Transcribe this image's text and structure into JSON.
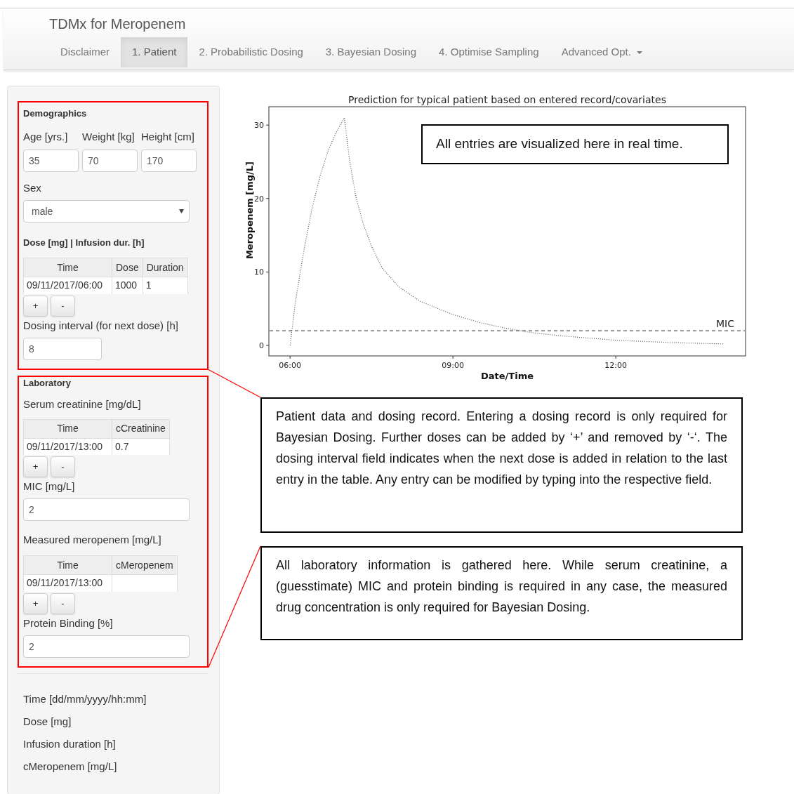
{
  "app_title": "TDMx for Meropenem",
  "tabs": [
    {
      "label": "Disclaimer",
      "selected": false,
      "has_menu": false
    },
    {
      "label": "1. Patient",
      "selected": true,
      "has_menu": false
    },
    {
      "label": "2. Probabilistic Dosing",
      "selected": false,
      "has_menu": false
    },
    {
      "label": "3. Bayesian Dosing",
      "selected": false,
      "has_menu": false
    },
    {
      "label": "4. Optimise Sampling",
      "selected": false,
      "has_menu": false
    },
    {
      "label": "Advanced Opt.",
      "selected": false,
      "has_menu": true
    }
  ],
  "sidebar": {
    "sections": [
      {
        "title": "Demographics",
        "highlighted": true,
        "items": [
          {
            "kind": "inputs",
            "fields": [
              {
                "label": "Age [yrs.]",
                "value": "35"
              },
              {
                "label": "Weight [kg]",
                "value": "70"
              },
              {
                "label": "Height [cm]",
                "value": "170"
              }
            ]
          },
          {
            "kind": "select",
            "label": "Sex",
            "value": "male"
          },
          {
            "kind": "subheading",
            "text": "Dose [mg] | Infusion dur. [h]"
          },
          {
            "kind": "table",
            "columns": [
              "Time",
              "Dose",
              "Duration"
            ],
            "rows": [
              [
                "09/11/2017/06:00",
                "1000",
                "1"
              ]
            ],
            "buttons": [
              "+",
              "-"
            ]
          },
          {
            "kind": "short-input",
            "label": "Dosing interval (for next dose) [h]",
            "value": "8"
          }
        ]
      },
      {
        "title": "Laboratory",
        "highlighted": true,
        "items": [
          {
            "kind": "label",
            "text": "Serum creatinine [mg/dL]"
          },
          {
            "kind": "table",
            "columns": [
              "Time",
              "cCreatinine"
            ],
            "rows": [
              [
                "09/11/2017/13:00",
                "0.7"
              ]
            ],
            "buttons": [
              "+",
              "-"
            ]
          },
          {
            "kind": "input",
            "label": "MIC [mg/L]",
            "value": "2"
          },
          {
            "kind": "label",
            "text": "Measured meropenem [mg/L]"
          },
          {
            "kind": "table",
            "columns": [
              "Time",
              "cMeropenem"
            ],
            "rows": [
              [
                "09/11/2017/13:00",
                null
              ]
            ],
            "buttons": [
              "+",
              "-"
            ]
          },
          {
            "kind": "input",
            "label": "Protein Binding [%]",
            "value": "2"
          }
        ]
      },
      {
        "highlighted": false,
        "items": [
          {
            "kind": "label",
            "text": "Time [dd/mm/yyyy/hh:mm]"
          },
          {
            "kind": "label",
            "text": "Dose [mg]"
          },
          {
            "kind": "label",
            "text": "Infusion duration [h]"
          },
          {
            "kind": "label",
            "text": "cMeropenem [mg/L]"
          }
        ]
      }
    ]
  },
  "chart": {
    "note": "All entries are visualized here in real time.",
    "chart_data": {
      "type": "line",
      "title": "Prediction for typical patient based on entered record/covariates",
      "xlabel": "Date/Time",
      "ylabel": "Meropenem [mg/L]",
      "x": [
        6,
        6.1,
        6.25,
        6.4,
        6.55,
        6.7,
        6.85,
        7,
        7.1,
        7.22,
        7.35,
        7.5,
        7.7,
        8,
        8.4,
        9,
        9.5,
        10,
        10.5,
        11,
        12,
        13,
        14
      ],
      "series": [
        {
          "color": "#555555",
          "line_style": "dotted",
          "values": [
            0,
            6,
            12.7,
            18.5,
            23,
            26.5,
            29,
            31,
            25,
            20,
            16.5,
            13.5,
            10.5,
            8,
            6,
            4.2,
            3.1,
            2.3,
            1.7,
            1.3,
            0.7,
            0.4,
            0.2
          ]
        }
      ],
      "xlim": [
        5.61,
        14.39
      ],
      "ylim": [
        -1.43,
        32.5
      ],
      "xticks": [
        {
          "value": 6,
          "label": "06:00"
        },
        {
          "value": 9,
          "label": "09:00"
        },
        {
          "value": 12,
          "label": "12:00"
        }
      ],
      "yticks": [
        0,
        10,
        20,
        30
      ],
      "ref_lines": [
        {
          "axis": "y",
          "value": 2,
          "label": "MIC",
          "line_style": "dashed"
        }
      ]
    }
  },
  "callouts": [
    {
      "text": "Patient data and dosing record. Entering a dosing record is only required for Bayesian Dosing. Further doses can be added by ‘+’ and removed by ‘-‘. The dosing interval field indicates when the next dose is added in relation to the last entry in the table. Any entry can be modified by typing into the respective field."
    },
    {
      "text": "All laboratory information is gathered here. While serum creatinine, a (guesstimate) MIC and protein binding is required in any case, the measured drug concentration is only required for Bayesian Dosing."
    }
  ]
}
